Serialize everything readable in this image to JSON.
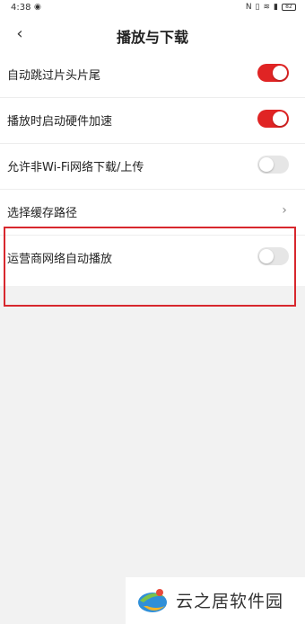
{
  "status_bar": {
    "time": "4:38",
    "eye_icon": "eye-icon",
    "right_icons": [
      "nfc-icon",
      "vibrate-icon",
      "wifi-icon",
      "signal-icon"
    ],
    "battery": "82"
  },
  "header": {
    "title": "播放与下载",
    "back_icon": "chevron-left-icon"
  },
  "settings": [
    {
      "label": "自动跳过片头片尾",
      "control": "toggle",
      "on": true
    },
    {
      "label": "播放时启动硬件加速",
      "control": "toggle",
      "on": true
    },
    {
      "label": "允许非Wi-Fi网络下载/上传",
      "control": "toggle",
      "on": false
    },
    {
      "label": "选择缓存路径",
      "control": "chevron"
    },
    {
      "label": "运营商网络自动播放",
      "control": "toggle",
      "on": false
    }
  ],
  "colors": {
    "accent": "#e02424",
    "toggle_off": "#e6e6e6",
    "highlight": "#d8282e"
  },
  "watermark": {
    "text": "云之居软件园",
    "logo_icon": "swirl-logo"
  }
}
